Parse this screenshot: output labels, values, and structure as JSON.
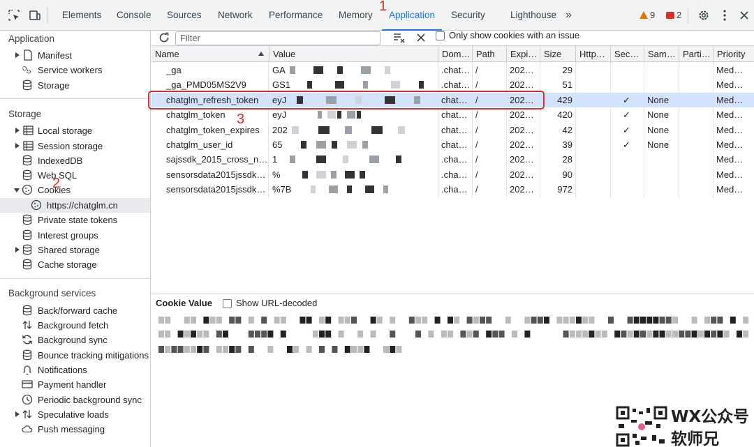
{
  "toolbar": {
    "tabs": [
      {
        "label": "Elements"
      },
      {
        "label": "Console"
      },
      {
        "label": "Sources"
      },
      {
        "label": "Network"
      },
      {
        "label": "Performance"
      },
      {
        "label": "Memory"
      },
      {
        "label": "Application"
      },
      {
        "label": "Security"
      },
      {
        "label": "Lighthouse"
      }
    ],
    "more_label": "»",
    "warnings_count": "9",
    "errors_count": "2"
  },
  "annotations": {
    "one": "1",
    "two": "2",
    "three": "3"
  },
  "sidebar": {
    "application_title": "Application",
    "application_items": [
      {
        "label": "Manifest",
        "icon": "file-icon"
      },
      {
        "label": "Service workers",
        "icon": "gears-icon"
      },
      {
        "label": "Storage",
        "icon": "database-icon"
      }
    ],
    "storage_title": "Storage",
    "storage_items": [
      {
        "label": "Local storage",
        "icon": "table-icon"
      },
      {
        "label": "Session storage",
        "icon": "table-icon"
      },
      {
        "label": "IndexedDB",
        "icon": "database-icon"
      },
      {
        "label": "Web SQL",
        "icon": "database-icon"
      },
      {
        "label": "Cookies",
        "icon": "cookie-icon"
      },
      {
        "label": "https://chatglm.cn",
        "icon": "cookie-icon"
      },
      {
        "label": "Private state tokens",
        "icon": "database-icon"
      },
      {
        "label": "Interest groups",
        "icon": "database-icon"
      },
      {
        "label": "Shared storage",
        "icon": "database-icon"
      },
      {
        "label": "Cache storage",
        "icon": "database-icon"
      }
    ],
    "bg_title": "Background services",
    "bg_items": [
      {
        "label": "Back/forward cache",
        "icon": "database-icon"
      },
      {
        "label": "Background fetch",
        "icon": "updown-arrows-icon"
      },
      {
        "label": "Background sync",
        "icon": "sync-icon"
      },
      {
        "label": "Bounce tracking mitigations",
        "icon": "database-icon"
      },
      {
        "label": "Notifications",
        "icon": "bell-icon"
      },
      {
        "label": "Payment handler",
        "icon": "card-icon"
      },
      {
        "label": "Periodic background sync",
        "icon": "clock-icon"
      },
      {
        "label": "Speculative loads",
        "icon": "updown-arrows-icon"
      },
      {
        "label": "Push messaging",
        "icon": "cloud-icon"
      }
    ]
  },
  "filter": {
    "placeholder": "Filter",
    "only_issues_label": "Only show cookies with an issue"
  },
  "table": {
    "columns": [
      "Name",
      "Value",
      "Dom…",
      "Path",
      "Expi…",
      "Size",
      "Http…",
      "Sec…",
      "Sam…",
      "Parti…",
      "Priority"
    ],
    "rows": [
      {
        "name": "_ga",
        "value": "GA",
        "domain": ".chat…",
        "path": "/",
        "expires": "202…",
        "size": "29",
        "http": "",
        "secure": "",
        "samesite": "",
        "partition": "",
        "priority": "Med…"
      },
      {
        "name": "_ga_PMD05MS2V9",
        "value": "GS1",
        "domain": ".chat…",
        "path": "/",
        "expires": "202…",
        "size": "51",
        "http": "",
        "secure": "",
        "samesite": "",
        "partition": "",
        "priority": "Med…"
      },
      {
        "name": "chatglm_refresh_token",
        "value": "eyJ",
        "domain": "chat…",
        "path": "/",
        "expires": "202…",
        "size": "429",
        "http": "",
        "secure": "✓",
        "samesite": "None",
        "partition": "",
        "priority": "Med…"
      },
      {
        "name": "chatglm_token",
        "value": "eyJ",
        "domain": "chat…",
        "path": "/",
        "expires": "202…",
        "size": "420",
        "http": "",
        "secure": "✓",
        "samesite": "None",
        "partition": "",
        "priority": "Med…"
      },
      {
        "name": "chatglm_token_expires",
        "value": "202",
        "domain": "chat…",
        "path": "/",
        "expires": "202…",
        "size": "42",
        "http": "",
        "secure": "✓",
        "samesite": "None",
        "partition": "",
        "priority": "Med…"
      },
      {
        "name": "chatglm_user_id",
        "value": "65",
        "domain": "chat…",
        "path": "/",
        "expires": "202…",
        "size": "39",
        "http": "",
        "secure": "✓",
        "samesite": "None",
        "partition": "",
        "priority": "Med…"
      },
      {
        "name": "sajssdk_2015_cross_n…",
        "value": "1",
        "domain": ".cha…",
        "path": "/",
        "expires": "202…",
        "size": "28",
        "http": "",
        "secure": "",
        "samesite": "",
        "partition": "",
        "priority": "Med…"
      },
      {
        "name": "sensorsdata2015jssdk…",
        "value": "%",
        "domain": ".cha…",
        "path": "/",
        "expires": "202…",
        "size": "90",
        "http": "",
        "secure": "",
        "samesite": "",
        "partition": "",
        "priority": "Med…"
      },
      {
        "name": "sensorsdata2015jssdk…",
        "value": "%7B",
        "domain": ".cha…",
        "path": "/",
        "expires": "202…",
        "size": "972",
        "http": "",
        "secure": "",
        "samesite": "",
        "partition": "",
        "priority": "Med…"
      }
    ]
  },
  "cookie_value": {
    "title": "Cookie Value",
    "show_decoded_label": "Show URL-decoded"
  },
  "watermark": {
    "line1": "WX公众号",
    "line2": "软师兄"
  }
}
